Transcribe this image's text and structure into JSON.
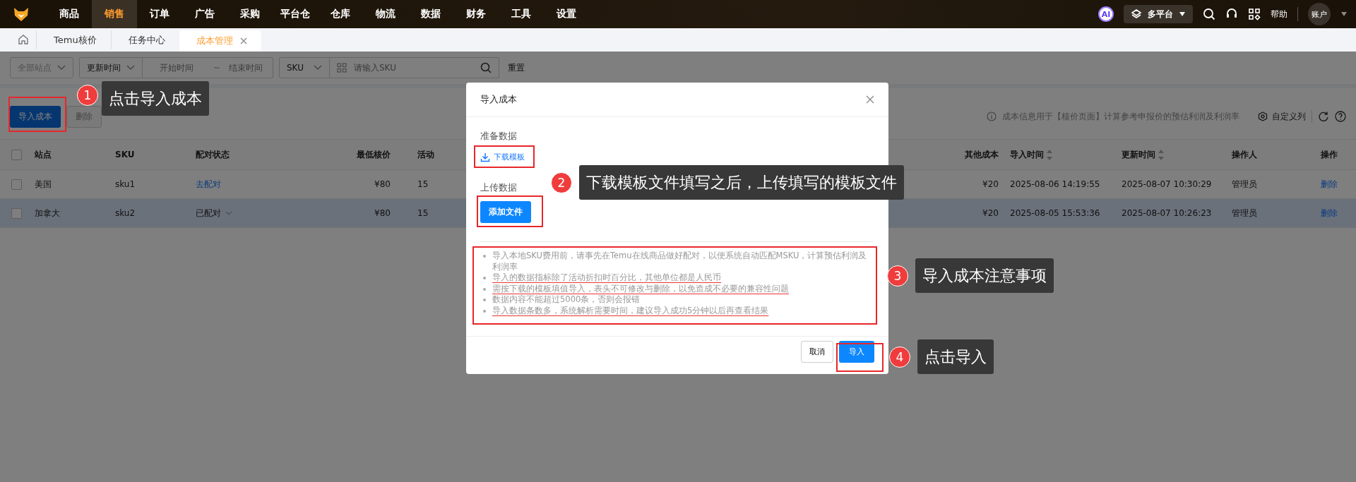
{
  "nav": {
    "items": [
      {
        "label": "商品",
        "selected": false
      },
      {
        "label": "销售",
        "selected": true
      },
      {
        "label": "订单",
        "selected": false
      },
      {
        "label": "广告",
        "selected": false
      },
      {
        "label": "采购",
        "selected": false
      },
      {
        "label": "平台仓",
        "selected": false
      },
      {
        "label": "仓库",
        "selected": false
      },
      {
        "label": "物流",
        "selected": false
      },
      {
        "label": "数据",
        "selected": false
      },
      {
        "label": "财务",
        "selected": false
      },
      {
        "label": "工具",
        "selected": false
      },
      {
        "label": "设置",
        "selected": false
      }
    ],
    "ai_badge": "AI",
    "platform": "多平台",
    "help": "帮助",
    "account": "账户"
  },
  "tabs": [
    {
      "label": "Temu核价",
      "selected": false,
      "closable": false
    },
    {
      "label": "任务中心",
      "selected": false,
      "closable": false
    },
    {
      "label": "成本管理",
      "selected": true,
      "closable": true
    }
  ],
  "filters": {
    "site": "全部站点",
    "time_type": "更新时间",
    "start_placeholder": "开始时间",
    "range_separator": "~",
    "end_placeholder": "结束时间",
    "field": "SKU",
    "search_placeholder": "请输入SKU",
    "reset": "重置"
  },
  "toolbar": {
    "buttons": [
      {
        "label": "导入成本",
        "kind": "primary",
        "disabled": false
      },
      {
        "label": "删除",
        "kind": "default",
        "disabled": true
      }
    ],
    "info": "成本信息用于【核价页面】计算参考申报价的预估利润及利润率",
    "customize": "自定义列"
  },
  "table": {
    "all_checked": false,
    "columns": [
      {
        "label": "站点",
        "sortable": false
      },
      {
        "label": "SKU",
        "sortable": false
      },
      {
        "label": "配对状态",
        "sortable": false
      },
      {
        "label": "最低核价",
        "sortable": false
      },
      {
        "label": "活动",
        "sortable": false
      },
      {
        "label": "其他成本",
        "sortable": false
      },
      {
        "label": "导入时间",
        "sortable": true
      },
      {
        "label": "更新时间",
        "sortable": true
      },
      {
        "label": "操作人",
        "sortable": false
      },
      {
        "label": "操作",
        "sortable": false
      }
    ],
    "rows": [
      {
        "checked": false,
        "highlighted": false,
        "site": "美国",
        "sku": "sku1",
        "pairing": {
          "text": "去配对",
          "matched": false
        },
        "min_price": "¥80",
        "activity": "15",
        "other_cost": "¥20",
        "import_time": "2025-08-06 14:19:55",
        "update_time": "2025-08-07 10:30:29",
        "operator": "管理员",
        "action": "删除"
      },
      {
        "checked": false,
        "highlighted": true,
        "site": "加拿大",
        "sku": "sku2",
        "pairing": {
          "text": "已配对",
          "matched": true
        },
        "min_price": "¥80",
        "activity": "15",
        "other_cost": "¥20",
        "import_time": "2025-08-05 15:53:36",
        "update_time": "2025-08-07 10:26:23",
        "operator": "管理员",
        "action": "删除"
      }
    ]
  },
  "modal": {
    "title": "导入成本",
    "prepare_label": "准备数据",
    "download": "下载模板",
    "upload_label": "上传数据",
    "add_file": "添加文件",
    "notes": [
      {
        "text": "导入本地SKU费用前，请事先在Temu在线商品做好配对，以便系统自动匹配MSKU，计算预估利润及利润率",
        "underlined": false
      },
      {
        "text": "导入的数据指标除了活动折扣时百分比，其他单位都是人民币",
        "underlined": true
      },
      {
        "text": "需按下载的模板填值导入，表头不可修改与删除，以免造成不必要的兼容性问题",
        "underlined": true
      },
      {
        "text": "数据内容不能超过5000条，否则会报错",
        "underlined": false
      },
      {
        "text": "导入数据条数多，系统解析需要时间，建议导入成功5分钟以后再查看结果",
        "underlined": true
      }
    ],
    "cancel": "取消",
    "confirm": "导入"
  },
  "callouts": [
    {
      "number": "1",
      "text": "点击导入成本"
    },
    {
      "number": "2",
      "text": "下载模板文件填写之后，上传填写的模板文件"
    },
    {
      "number": "3",
      "text": "导入成本注意事项"
    },
    {
      "number": "4",
      "text": "点击导入"
    }
  ]
}
